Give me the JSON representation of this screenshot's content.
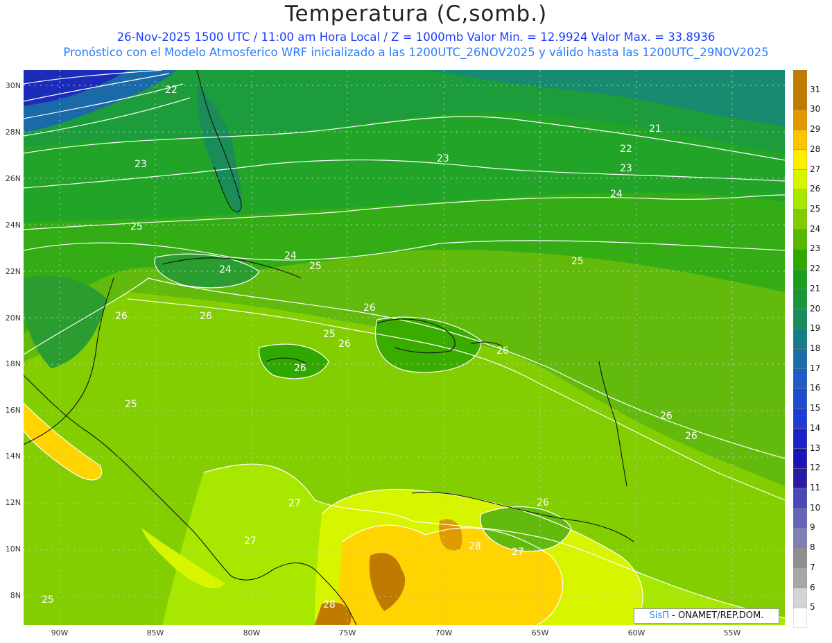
{
  "header": {
    "title": "Temperatura (C,somb.)",
    "subtitle1": "26-Nov-2025 1500 UTC / 11:00 am Hora Local / Z = 1000mb  Valor Min. = 12.9924  Valor Max. = 33.8936",
    "subtitle2": "Pronóstico con el Modelo Atmosferico WRF inicializado a las 1200UTC_26NOV2025 y válido hasta las  1200UTC_29NOV2025"
  },
  "axes": {
    "lat_labels": [
      "30N",
      "28N",
      "26N",
      "24N",
      "22N",
      "20N",
      "18N",
      "16N",
      "14N",
      "12N",
      "10N",
      "8N"
    ],
    "lon_labels": [
      "90W",
      "85W",
      "80W",
      "75W",
      "70W",
      "65W",
      "60W",
      "55W"
    ]
  },
  "colorbar": {
    "labels": [
      "31",
      "30",
      "29",
      "28",
      "27",
      "26",
      "25",
      "24",
      "23",
      "22",
      "21",
      "20",
      "19",
      "18",
      "17",
      "16",
      "15",
      "14",
      "13",
      "12",
      "11",
      "10",
      "9",
      "8",
      "7",
      "6",
      "5"
    ],
    "colors": [
      "#c07a00",
      "#e09a00",
      "#ffc400",
      "#ffee00",
      "#d8f500",
      "#a8e800",
      "#80cc00",
      "#56b800",
      "#2fa800",
      "#1c9c1c",
      "#18963c",
      "#188c5c",
      "#187c84",
      "#1c6ca8",
      "#1e5cc8",
      "#1e4ccc",
      "#1e3cd2",
      "#1a22c8",
      "#1a14b8",
      "#2a1aa0",
      "#4848b8",
      "#6464b8",
      "#8080b8",
      "#909090",
      "#a8a8a8",
      "#d4d4d4",
      "#ffffff"
    ]
  },
  "contour_labels": [
    "22",
    "23",
    "23",
    "21",
    "22",
    "23",
    "24",
    "25",
    "24",
    "24",
    "25",
    "25",
    "26",
    "26",
    "26",
    "25",
    "26",
    "26",
    "26",
    "25",
    "26",
    "26",
    "27",
    "27",
    "26",
    "28",
    "27",
    "28",
    "25"
  ],
  "credit": {
    "brand": "SisΠ",
    "text": " - ONAMET/REP.DOM."
  }
}
